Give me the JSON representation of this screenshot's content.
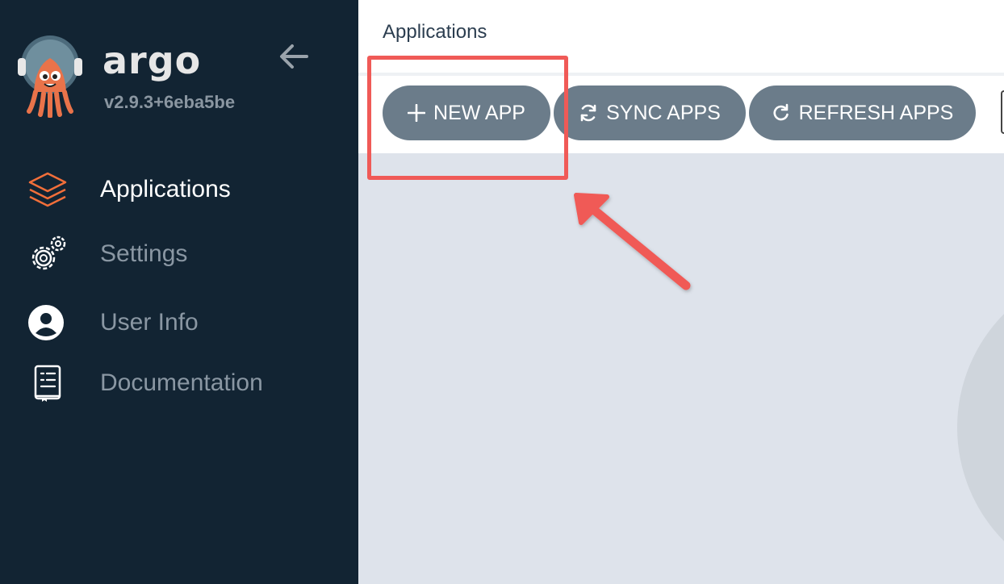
{
  "sidebar": {
    "brand": "argo",
    "version": "v2.9.3+6eba5be",
    "items": [
      {
        "label": "Applications",
        "icon": "layers-icon",
        "active": true
      },
      {
        "label": "Settings",
        "icon": "gears-icon",
        "active": false
      },
      {
        "label": "User Info",
        "icon": "user-circle-icon",
        "active": false
      },
      {
        "label": "Documentation",
        "icon": "book-icon",
        "active": false
      }
    ]
  },
  "header": {
    "title": "Applications"
  },
  "toolbar": {
    "new_app": "NEW APP",
    "sync_apps": "SYNC APPS",
    "refresh_apps": "REFRESH APPS"
  },
  "colors": {
    "sidebar_bg": "#122433",
    "accent_orange": "#f26f3a",
    "button_bg": "#6b7c8a",
    "annotation_red": "#f05a57",
    "content_bg": "#dee3eb"
  }
}
